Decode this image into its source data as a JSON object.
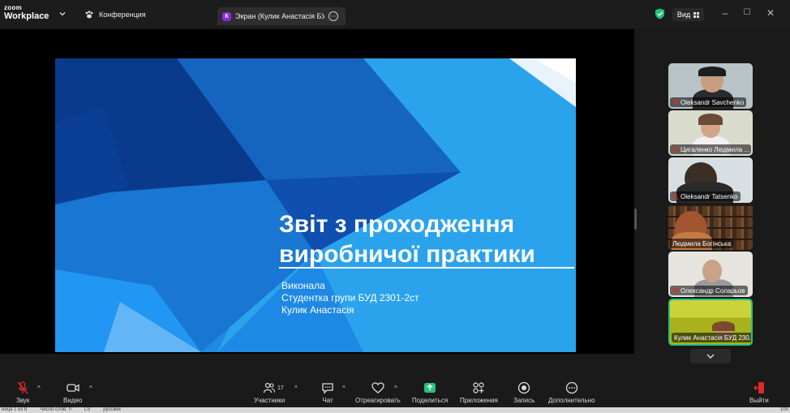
{
  "titlebar": {
    "logo_top": "zoom",
    "logo_bottom": "Workplace",
    "conference_tab": "Конференция",
    "screen_tab_letter": "К",
    "screen_tab_title": "Экран (Кулик Анастасія БУД 2301-2ст)",
    "view_label": "Вид"
  },
  "slide": {
    "title_line1": "Звіт з проходження",
    "title_line2": "виробничої практики",
    "sub_line1": "Виконала",
    "sub_line2": "Студентка групи БУД 2301-2ст",
    "sub_line3": "Кулик Анастасія"
  },
  "participants": [
    {
      "name": "Oleksandr Savchenko",
      "muted": true
    },
    {
      "name": "Цигаленко Людмила ...",
      "muted": true
    },
    {
      "name": "Oleksandr Tatsenko",
      "muted": true
    },
    {
      "name": "Людмила Богінська",
      "muted": false
    },
    {
      "name": "Олександр Соларьов",
      "muted": true
    },
    {
      "name": "Кулик Анастасія БУД 230...",
      "muted": false,
      "active": true
    }
  ],
  "toolbar": {
    "audio": "Звук",
    "video": "Видео",
    "participants": "Участники",
    "participants_count": "17",
    "chat": "Чат",
    "react": "Отреагировать",
    "share": "Поделиться",
    "apps": "Приложения",
    "record": "Запись",
    "more": "Дополнительно",
    "leave": "Выйти"
  },
  "statusbar": {
    "page": "ница 1 из 8",
    "words": "Число слов: 0",
    "lang_code": "LS",
    "lang": "русский",
    "zoom": "100"
  },
  "colors": {
    "accent_green": "#27c27a",
    "leave_red": "#e02828",
    "slide_blue": "#1e88e5"
  }
}
